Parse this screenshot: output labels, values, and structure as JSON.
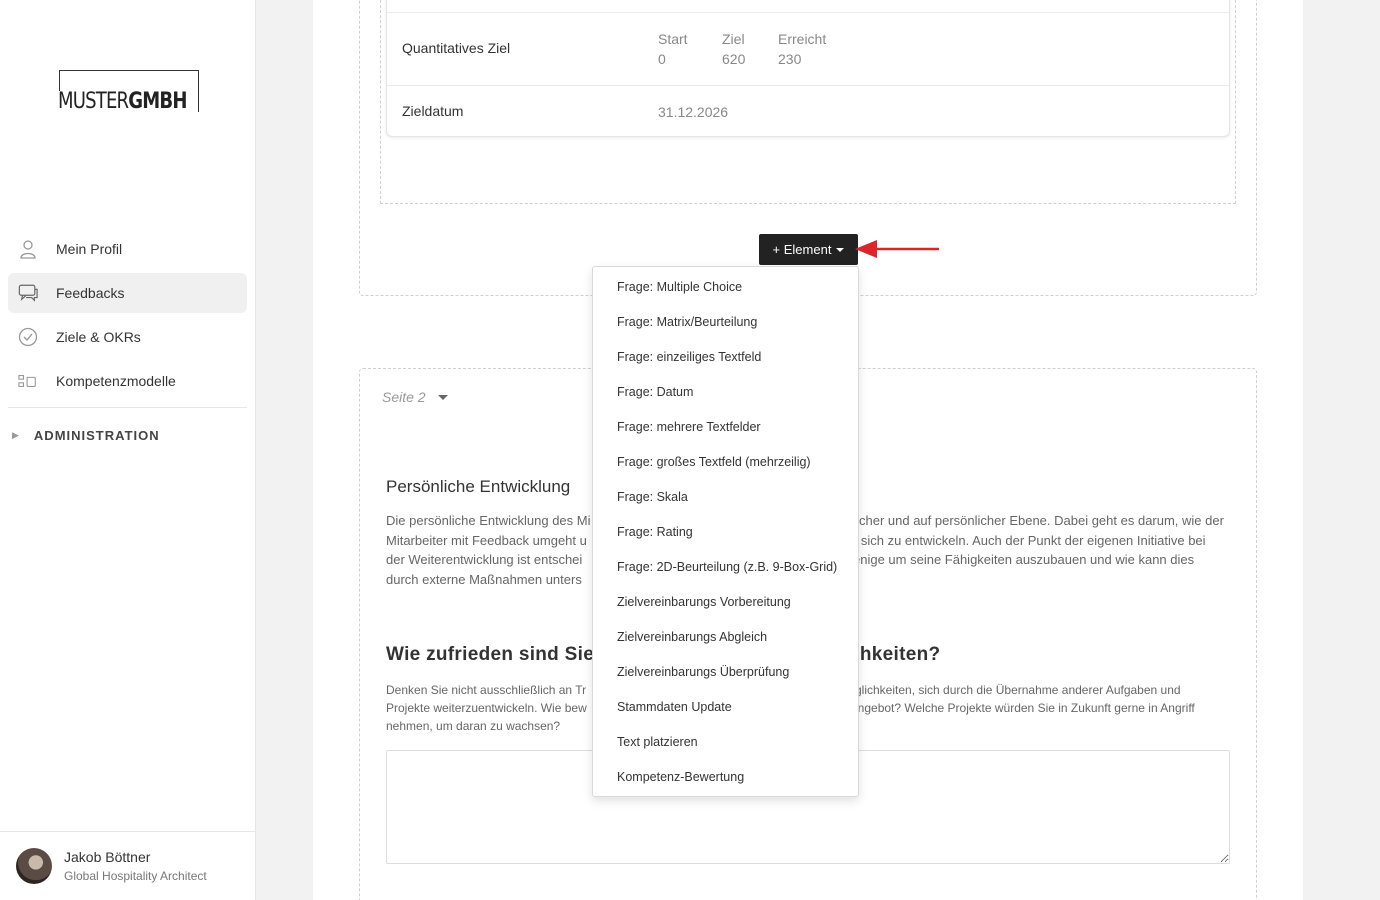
{
  "logo": {
    "part1": "MUSTER",
    "part2": "GMBH"
  },
  "nav": {
    "items": [
      {
        "label": "Mein Profil",
        "icon": "user-icon"
      },
      {
        "label": "Feedbacks",
        "icon": "chat-icon"
      },
      {
        "label": "Ziele & OKRs",
        "icon": "check-circle-icon"
      },
      {
        "label": "Kompetenzmodelle",
        "icon": "competency-icon"
      }
    ],
    "active": "Feedbacks",
    "admin_label": "ADMINISTRATION"
  },
  "user": {
    "name": "Jakob Böttner",
    "role": "Global Hospitality Architect"
  },
  "goal_card": {
    "quant_label": "Quantitatives Ziel",
    "start_label": "Start",
    "start_value": "0",
    "ziel_label": "Ziel",
    "ziel_value": "620",
    "erreicht_label": "Erreicht",
    "erreicht_value": "230",
    "date_label": "Zieldatum",
    "date_value": "31.12.2026"
  },
  "element_button": {
    "label": "+ Element"
  },
  "dropdown": {
    "items": [
      "Frage: Multiple Choice",
      "Frage: Matrix/Beurteilung",
      "Frage: einzeiliges Textfeld",
      "Frage: Datum",
      "Frage: mehrere Textfelder",
      "Frage: großes Textfeld (mehrzeilig)",
      "Frage: Skala",
      "Frage: Rating",
      "Frage: 2D-Beurteilung (z.B. 9-Box-Grid)",
      "Zielvereinbarungs Vorbereitung",
      "Zielvereinbarungs Abgleich",
      "Zielvereinbarungs Überprüfung",
      "Stammdaten Update",
      "Text platzieren",
      "Kompetenz-Bewertung"
    ]
  },
  "page2": {
    "label": "Seite 2",
    "section_title": "Persönliche Entwicklung",
    "section_text_a": "Die persönliche Entwicklung des Mi",
    "section_text_b": "cher und auf persönlicher Ebene. Dabei geht es darum, wie der",
    "section_text_c": "Mitarbeiter mit Feedback umgeht u",
    "section_text_d": "d sich zu entwickeln. Auch der Punkt der eigenen Initiative bei",
    "section_text_e": "der Weiterentwicklung ist entschei",
    "section_text_f": "enige um seine Fähigkeiten auszubauen und wie kann dies",
    "section_text_g": "durch externe Maßnahmen unters",
    "question_a": "Wie zufrieden sind Sie",
    "question_b": "chkeiten?",
    "question_text_a": "Denken Sie nicht ausschließlich an Tr",
    "question_text_b": "glichkeiten, sich durch die Übernahme anderer Aufgaben und",
    "question_text_c": "Projekte weiterzuentwickeln. Wie bew",
    "question_text_d": "angebot? Welche Projekte würden Sie in Zukunft gerne in Angriff",
    "question_text_e": "nehmen, um daran zu wachsen?"
  },
  "colors": {
    "arrow": "#d9252b",
    "button_bg": "#222222",
    "active_nav_bg": "#f0f0f0"
  }
}
